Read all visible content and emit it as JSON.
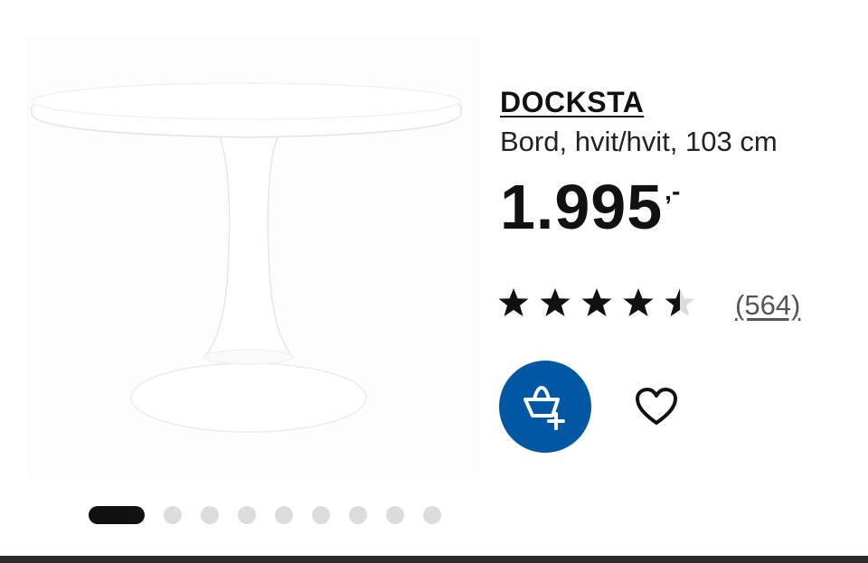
{
  "product": {
    "name": "DOCKSTA",
    "description": "Bord, hvit/hvit, 103 cm",
    "price": "1.995",
    "price_suffix": ",-",
    "image_alt": "DOCKSTA table"
  },
  "rating": {
    "value": 4.5,
    "max": 5,
    "reviews_label": "(564)"
  },
  "actions": {
    "cart_icon": "add-to-cart-icon",
    "favourite_icon": "heart-icon"
  },
  "carousel": {
    "total": 9,
    "active_index": 0
  },
  "colors": {
    "accent": "#0058a3",
    "text": "#111111",
    "star_filled": "#111111",
    "star_empty": "#dcdcdc",
    "dot_inactive": "#dcdcdc"
  }
}
